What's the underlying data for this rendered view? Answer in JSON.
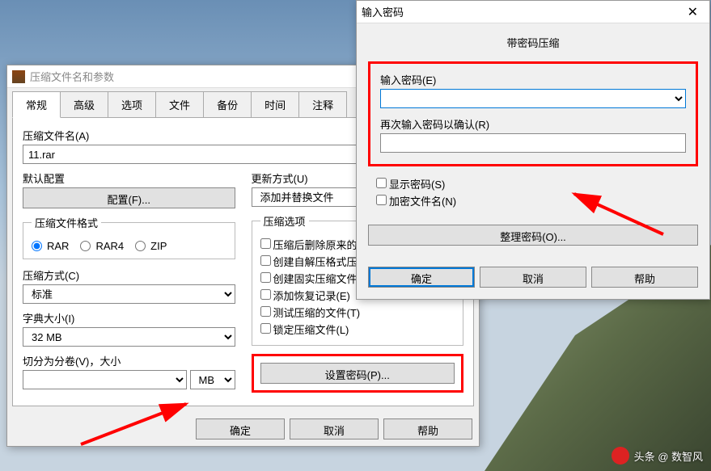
{
  "main": {
    "title": "压缩文件名和参数",
    "tabs": [
      "常规",
      "高级",
      "选项",
      "文件",
      "备份",
      "时间",
      "注释"
    ],
    "archive_name_label": "压缩文件名(A)",
    "archive_name_value": "11.rar",
    "default_profile_label": "默认配置",
    "profile_btn": "配置(F)...",
    "update_mode_label": "更新方式(U)",
    "update_mode_value": "添加并替换文件",
    "format_label": "压缩文件格式",
    "formats": {
      "rar": "RAR",
      "rar4": "RAR4",
      "zip": "ZIP"
    },
    "method_label": "压缩方式(C)",
    "method_value": "标准",
    "dict_label": "字典大小(I)",
    "dict_value": "32 MB",
    "split_label": "切分为分卷(V)，大小",
    "split_unit": "MB",
    "options_label": "压缩选项",
    "options": {
      "delete": "压缩后删除原来的文件",
      "sfx": "创建自解压格式压缩文件",
      "solid": "创建固实压缩文件(S)",
      "recovery": "添加恢复记录(E)",
      "test": "测试压缩的文件(T)",
      "lock": "锁定压缩文件(L)"
    },
    "set_password_btn": "设置密码(P)...",
    "ok": "确定",
    "cancel": "取消",
    "help": "帮助"
  },
  "pwd": {
    "title": "输入密码",
    "subtitle": "带密码压缩",
    "enter_label": "输入密码(E)",
    "confirm_label": "再次输入密码以确认(R)",
    "show_pwd": "显示密码(S)",
    "encrypt_names": "加密文件名(N)",
    "organize_btn": "整理密码(O)...",
    "ok": "确定",
    "cancel": "取消",
    "help": "帮助"
  },
  "watermark": "头条 @ 数智风"
}
